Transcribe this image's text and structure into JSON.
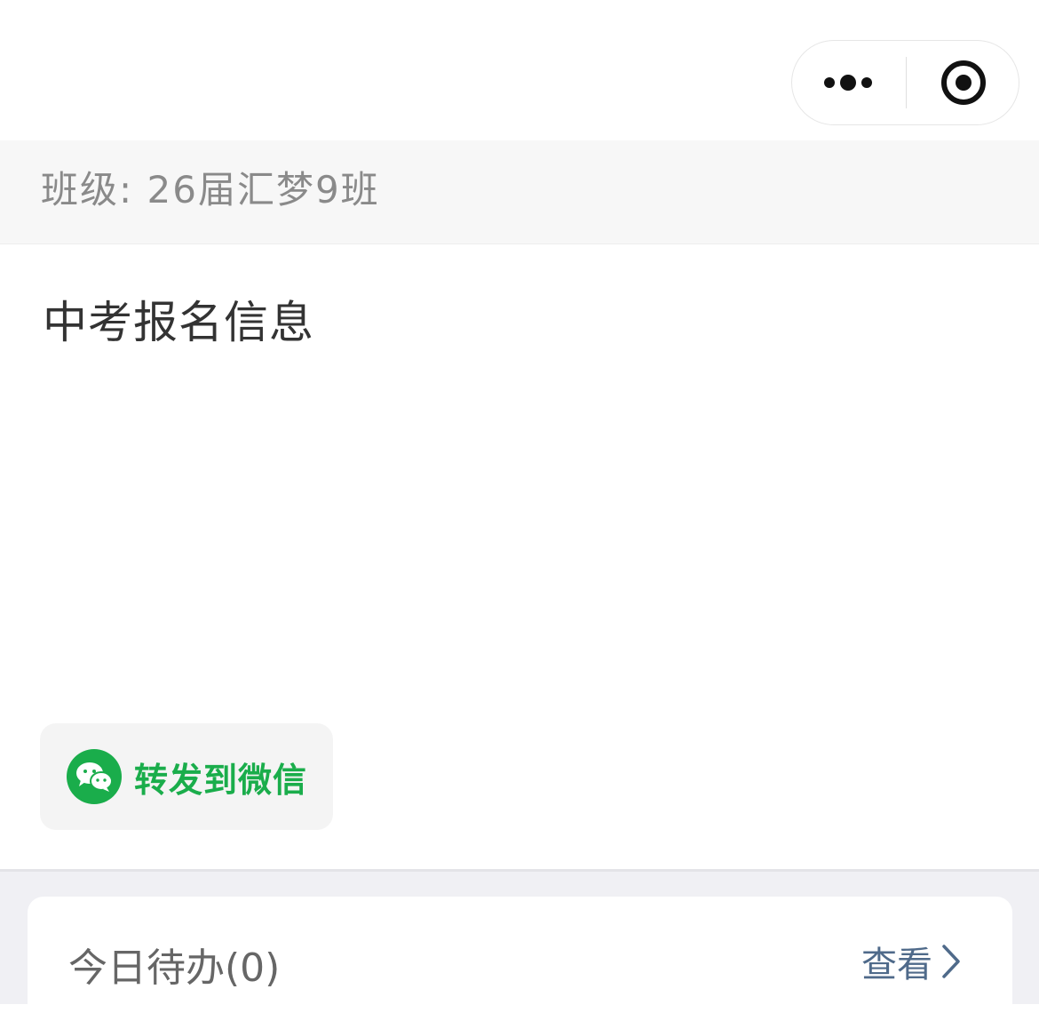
{
  "class_bar": {
    "label": "班级: 26届汇梦9班"
  },
  "notice": {
    "title": "中考报名信息"
  },
  "share": {
    "label": "转发到微信",
    "icon": "wechat-icon",
    "color": "#1aad4b"
  },
  "todo": {
    "title": "今日待办(0)",
    "view_label": "查看"
  },
  "capsule": {
    "more_icon": "more-dots-icon",
    "close_icon": "target-close-icon"
  }
}
